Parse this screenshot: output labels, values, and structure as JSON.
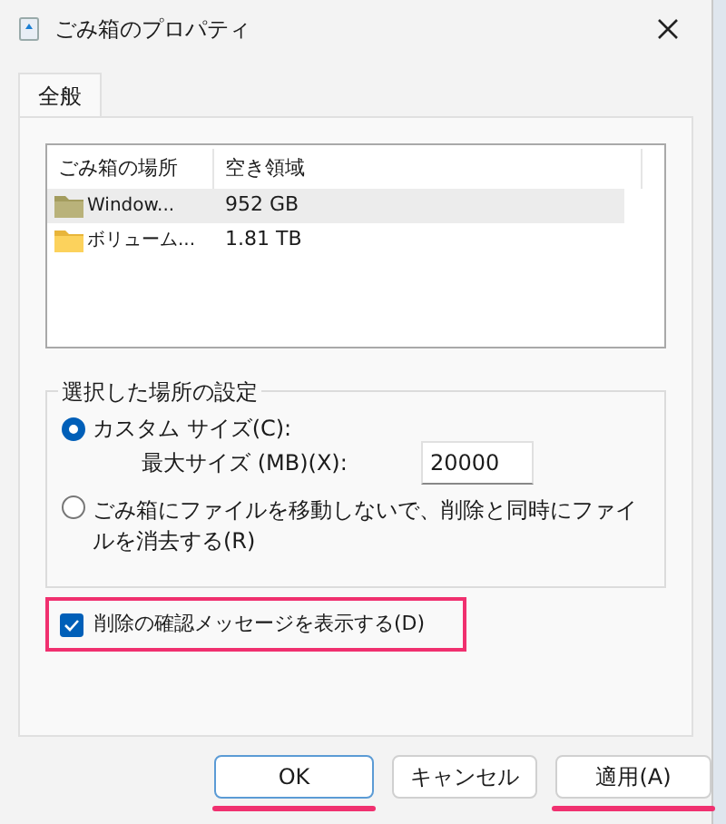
{
  "window": {
    "title": "ごみ箱のプロパティ"
  },
  "tabs": [
    {
      "label": "全般",
      "selected": true
    }
  ],
  "locations": {
    "columns": [
      "ごみ箱の場所",
      "空き領域"
    ],
    "rows": [
      {
        "name": "Window...",
        "free": "952 GB",
        "selected": true
      },
      {
        "name": "ボリューム...",
        "free": "1.81 TB",
        "selected": false
      }
    ]
  },
  "settings": {
    "title": "選択した場所の設定",
    "options": [
      {
        "label": "カスタム サイズ(C):",
        "selected": true
      },
      {
        "label": "ごみ箱にファイルを移動しないで、削除と同時にファイルを消去する(R)",
        "selected": false
      }
    ],
    "max_size": {
      "label": "最大サイズ (MB)(X):",
      "value": "20000"
    }
  },
  "confirm": {
    "label": "削除の確認メッセージを表示する(D)",
    "checked": true,
    "annotated": true
  },
  "buttons": [
    {
      "label": "OK",
      "default": true,
      "annotated": true
    },
    {
      "label": "キャンセル",
      "default": false,
      "annotated": false
    },
    {
      "label": "適用(A)",
      "default": false,
      "annotated": true
    }
  ]
}
